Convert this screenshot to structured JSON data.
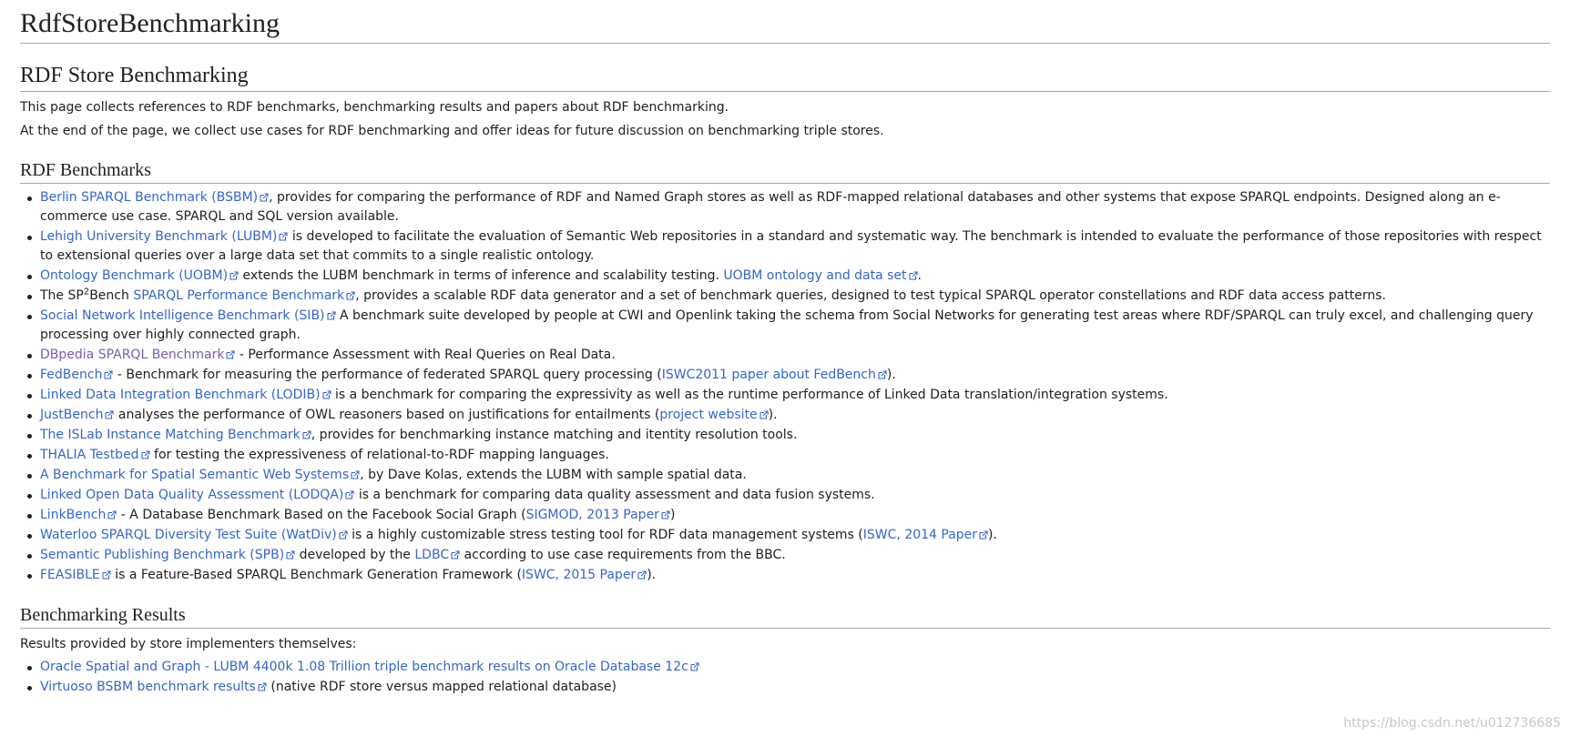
{
  "page_title": "RdfStoreBenchmarking",
  "main_heading": "RDF Store Benchmarking",
  "intro": [
    "This page collects references to RDF benchmarks, benchmarking results and papers about RDF benchmarking.",
    "At the end of the page, we collect use cases for RDF benchmarking and offer ideas for future discussion on benchmarking triple stores."
  ],
  "benchmarks_heading": "RDF Benchmarks",
  "benchmarks": [
    {
      "pre": "",
      "link": "Berlin SPARQL Benchmark (BSBM)",
      "text": ", provides for comparing the performance of RDF and Named Graph stores as well as RDF-mapped relational databases and other systems that expose SPARQL endpoints. Designed along an e-commerce use case. SPARQL and SQL version available."
    },
    {
      "pre": "",
      "link": "Lehigh University Benchmark (LUBM)",
      "text": " is developed to facilitate the evaluation of Semantic Web repositories in a standard and systematic way. The benchmark is intended to evaluate the performance of those repositories with respect to extensional queries over a large data set that commits to a single realistic ontology."
    },
    {
      "pre": "",
      "link": "Ontology Benchmark (UOBM)",
      "text": " extends the LUBM benchmark in terms of inference and scalability testing. ",
      "link2": "UOBM ontology and data set",
      "text2": "."
    },
    {
      "pre": "The SP",
      "sup": "2",
      "pre2": "Bench ",
      "link": "SPARQL Performance Benchmark",
      "text": ", provides a scalable RDF data generator and a set of benchmark queries, designed to test typical SPARQL operator constellations and RDF data access patterns."
    },
    {
      "pre": "",
      "link": "Social Network Intelligence Benchmark (SIB)",
      "text": " A benchmark suite developed by people at CWI and Openlink taking the schema from Social Networks for generating test areas where RDF/SPARQL can truly excel, and challenging query processing over highly connected graph."
    },
    {
      "pre": "",
      "link": "DBpedia SPARQL Benchmark",
      "visited": true,
      "text": " - Performance Assessment with Real Queries on Real Data."
    },
    {
      "pre": "",
      "link": "FedBench",
      "text": " - Benchmark for measuring the performance of federated SPARQL query processing (",
      "link2": "ISWC2011 paper about FedBench",
      "text2": ")."
    },
    {
      "pre": "",
      "link": "Linked Data Integration Benchmark (LODIB)",
      "text": " is a benchmark for comparing the expressivity as well as the runtime performance of Linked Data translation/integration systems."
    },
    {
      "pre": "",
      "link": "JustBench",
      "text": " analyses the performance of OWL reasoners based on justifications for entailments (",
      "link2": "project website",
      "text2": ")."
    },
    {
      "pre": "",
      "link": "The ISLab Instance Matching Benchmark",
      "text": ", provides for benchmarking instance matching and itentity resolution tools."
    },
    {
      "pre": "",
      "link": "THALIA Testbed",
      "text": " for testing the expressiveness of relational-to-RDF mapping languages."
    },
    {
      "pre": "",
      "link": "A Benchmark for Spatial Semantic Web Systems",
      "text": ", by Dave Kolas, extends the LUBM with sample spatial data."
    },
    {
      "pre": "",
      "link": "Linked Open Data Quality Assessment (LODQA)",
      "text": " is a benchmark for comparing data quality assessment and data fusion systems."
    },
    {
      "pre": "",
      "link": "LinkBench",
      "text": " - A Database Benchmark Based on the Facebook Social Graph (",
      "link2": "SIGMOD, 2013 Paper",
      "text2": ")"
    },
    {
      "pre": "",
      "link": "Waterloo SPARQL Diversity Test Suite (WatDiv)",
      "text": " is a highly customizable stress testing tool for RDF data management systems (",
      "link2": "ISWC, 2014 Paper",
      "text2": ")."
    },
    {
      "pre": "",
      "link": "Semantic Publishing Benchmark (SPB)",
      "text": " developed by the ",
      "link2": "LDBC",
      "text2": " according to use case requirements from the BBC."
    },
    {
      "pre": "",
      "link": "FEASIBLE",
      "text": " is a Feature-Based SPARQL Benchmark Generation Framework (",
      "link2": "ISWC, 2015 Paper",
      "text2": ")."
    }
  ],
  "results_heading": "Benchmarking Results",
  "results_intro": "Results provided by store implementers themselves:",
  "results": [
    {
      "pre": "",
      "link": "Oracle Spatial and Graph - LUBM 4400k 1.08 Trillion triple benchmark results on Oracle Database 12c",
      "text": ""
    },
    {
      "pre": "",
      "link": "Virtuoso BSBM benchmark results",
      "text": " (native RDF store versus mapped relational database)"
    }
  ],
  "watermark": "https://blog.csdn.net/u012736685",
  "colors": {
    "link": "#3366cc",
    "visited": "#795cb2",
    "text": "#202122",
    "rule": "#a2a9b1"
  },
  "icon": "external-link-icon"
}
